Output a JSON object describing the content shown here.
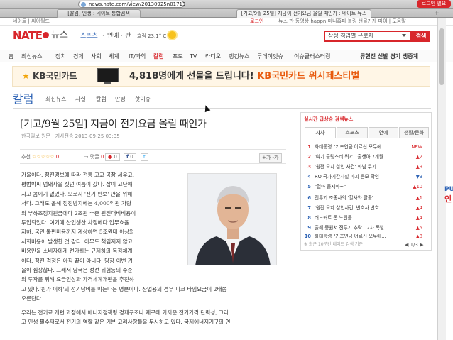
{
  "browser": {
    "url": "news.nate.com/view/20130925n01713",
    "login_button": "로그인 필요",
    "tabs": [
      {
        "label": "[칼럼] 인생 : 네이트 통합검색"
      },
      {
        "label": "[기고/9월 25일] 지금이 전기요금 올릴 때인가 : 네이트 뉴스"
      }
    ],
    "new_tab": "+"
  },
  "util_bar": {
    "left": "네이트 | 싸이월드",
    "login": "로그인",
    "right": "뉴스 판 동영상 happn 미니홈피 블링 선물가게 마이 | 도움말"
  },
  "header": {
    "logo": "NATE",
    "logo_sub": "뉴스",
    "services": [
      "스포츠",
      "연예",
      "판"
    ],
    "weather": "흐림 23.1° C",
    "search_value": "삼성 직업별 근로자",
    "search_button": "검색"
  },
  "gnb": {
    "items": [
      "홈",
      "최신뉴스",
      "정치",
      "경제",
      "사회",
      "세계",
      "IT/과학",
      "칼럼",
      "포토",
      "TV",
      "라디오",
      "랭킹뉴스",
      "투데이잇슈",
      "이슈클러스터링"
    ],
    "active": "칼럼",
    "promo": "류현진 선발 경기 생중계"
  },
  "banner": {
    "brand": "KB국민카드",
    "text_prefix": "4,818명에게 선물을 드립니다!",
    "text_highlight": "KB국민카드 위시페스티벌"
  },
  "section": {
    "title": "칼럼",
    "tabs": [
      "최신뉴스",
      "사설",
      "칼럼",
      "만평",
      "핫이슈"
    ]
  },
  "article": {
    "headline": "[기고/9월 25일] 지금이 전기요금 올릴 때인가",
    "byline": "한국일보 원문 | 기사전송 2013-09-25 03:35",
    "recommend_label": "추천",
    "recommend_count": "0",
    "reply_label": "댓글",
    "reply_count": "0",
    "share_count_a": "0",
    "share_count_b": "0",
    "font_buttons": "+가 -가",
    "lines_wrapped": [
      "가을이다. 정전경보에 따라 전통 고교 공장 세우고,",
      "평범박씨 멈돼사을 짓던 여름이 갔다. 삶이 고단해",
      "지고 콤이기 없었다. 오로지 '진기 만보' 만을 위해",
      "서다. 그래도 올해 정전방지에는 4,000억원 가량",
      "의 부하조정지원금에다 2조원 수준 원전대비비용이",
      "투입되었다. 여기에 산업생산 차질에다 업무효율",
      "저하, 국민 불편비용까지 계상하면 5조원대 이상의",
      "사회비용이 발생한 것 같다. 아무도 책임지지 않고",
      "비용만을 소비자에게 전가하는 규제하의 독점체계",
      "이다. 정전 걱정은 아직 끝이 아니다. 당장 이번 겨",
      "울이 심상찮다. 그래서 당국은 정전 위험등의 수준",
      "의 투자를 위해 요금인상과 가격체계개편을 추진하"
    ],
    "lines_full": [
      "고 있다.'원가 이하'의 전기낭비를 막는다는 명분이다. 산업용의 경우 피크 타임요금이 2배쯤",
      "오른단다."
    ],
    "lines_para2": [
      "우리는 전기료 개편 과정에서 에너지정책령 경제구조나 제로에 가까운 전기가격 탄력성, 그리",
      "고 민생 필수재로서 전기의 역할 같은 기본 고려사항들을 무시하고 있다. 국제에너지기구의 연"
    ]
  },
  "sidebar": {
    "title": "실시간 급상승 검색뉴스",
    "tabs": [
      "시사",
      "스포츠",
      "연예",
      "생활/문화"
    ],
    "active_tab": "시사",
    "ranks": [
      {
        "no": "1",
        "title": "화대통령 \"기초연금 어르신 모두에...",
        "change": "NEW"
      },
      {
        "no": "2",
        "title": "'여기 출렁스러 뭐?'…출생아 7개월...",
        "change": "▲2"
      },
      {
        "no": "3",
        "title": "'원전 모자 살인 사건' 화님 무기...",
        "change": "▲9"
      },
      {
        "no": "4",
        "title": "RO 국가기간시설 파괴 음모 확인",
        "change": "▼3"
      },
      {
        "no": "5",
        "title": "\"열마 몰지마~\"",
        "change": "▲10"
      },
      {
        "no": "6",
        "title": "전투기 조종사의 '힐사와 탈출'",
        "change": "▲1"
      },
      {
        "no": "7",
        "title": "'원전 모자 살인사건' 변호사 변호...",
        "change": "▲4"
      },
      {
        "no": "8",
        "title": "러드커트 돈 느린들",
        "change": "▲4"
      },
      {
        "no": "9",
        "title": "출해 증원서 전투기 추락…2차 폭발...",
        "change": "▲5"
      },
      {
        "no": "10",
        "title": "화대통령 \"기초연금 어르신 모두에...",
        "change": "▲8"
      }
    ],
    "footer": "※ 최근 10분간 네이트 검색 기준",
    "pager": "◀ 1/3 ▶"
  },
  "right_peek": {
    "a": "PU",
    "b": "인"
  },
  "colors": {
    "brand_red": "#d8262b",
    "link_blue": "#2f64b5",
    "banner_orange": "#e8590c"
  }
}
